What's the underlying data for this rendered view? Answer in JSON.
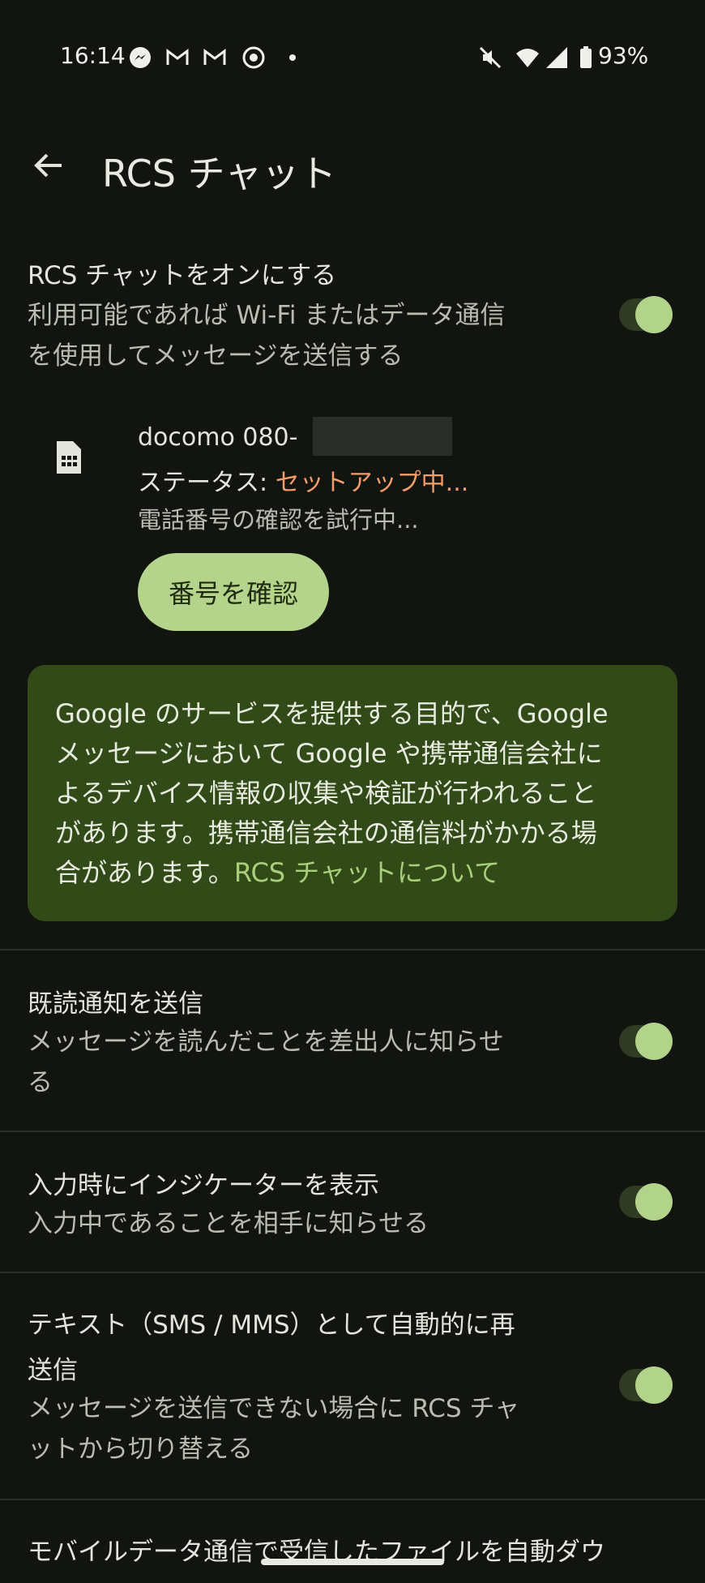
{
  "status_bar": {
    "time": "16:14",
    "battery": "93%",
    "icons": [
      "messenger-icon",
      "gmail-icon",
      "gmail-icon",
      "chrome-icon",
      "dot-icon",
      "mute-icon",
      "wifi-icon",
      "signal-icon",
      "battery-icon"
    ]
  },
  "header": {
    "title": "RCS チャット"
  },
  "rcs_toggle": {
    "title": "RCS チャットをオンにする",
    "sub1": "利用可能であれば Wi-Fi またはデータ通信",
    "sub2": "を使用してメッセージを送信する",
    "on": true
  },
  "sim": {
    "number": "docomo 080-",
    "status_label": "ステータス: ",
    "status_value": "セットアップ中...",
    "verifying": "電話番号の確認を試行中...",
    "verify_button": "番号を確認"
  },
  "info_card": {
    "line1": "Google のサービスを提供する目的で、Google",
    "line2": "メッセージにおいて Google や携帯通信会社に",
    "line3": "よるデバイス情報の収集や検証が行われること",
    "line4": "があります。携帯通信会社の通信料がかかる場",
    "line5": "合があります。",
    "link": "RCS チャットについて"
  },
  "read_receipts": {
    "title": "既読通知を送信",
    "sub1": "メッセージを読んだことを差出人に知らせ",
    "sub2": "る",
    "on": true
  },
  "typing_indicator": {
    "title": "入力時にインジケーターを表示",
    "sub1": "入力中であることを相手に知らせる",
    "on": true
  },
  "auto_resend": {
    "title1": "テキスト（SMS / MMS）として自動的に再",
    "title2": "送信",
    "sub1": "メッセージを送信できない場合に RCS チャ",
    "sub2": "ットから切り替える",
    "on": true
  },
  "auto_download": {
    "title": "モバイルデータ通信で受信したファイルを自動ダウ"
  }
}
